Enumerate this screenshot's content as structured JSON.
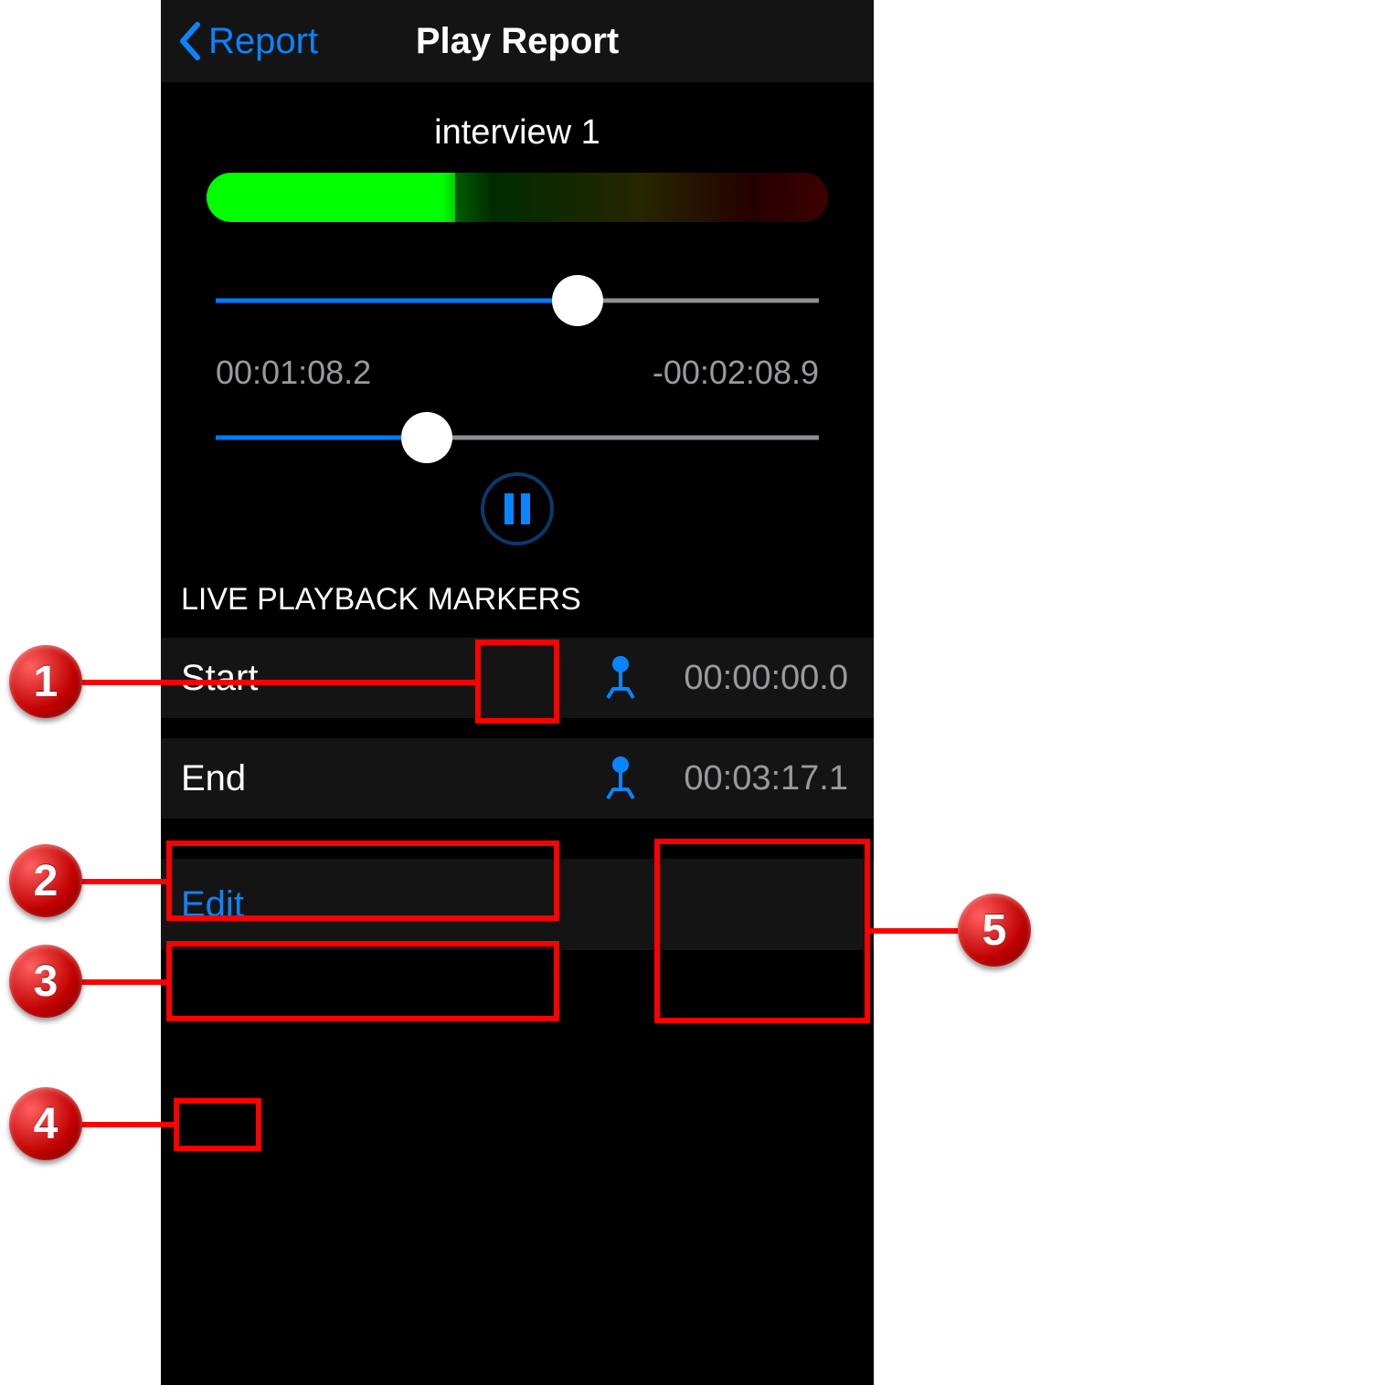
{
  "nav": {
    "back_label": "Report",
    "title": "Play Report"
  },
  "clip": {
    "title": "interview 1",
    "slider1_percent": 60,
    "time_elapsed": "00:01:08.2",
    "time_remaining": "-00:02:08.9",
    "slider2_percent": 35
  },
  "section": {
    "markers_header": "LIVE PLAYBACK MARKERS"
  },
  "markers": {
    "start_label": "Start",
    "start_time": "00:00:00.0",
    "end_label": "End",
    "end_time": "00:03:17.1"
  },
  "edit": {
    "label": "Edit"
  },
  "annotations": {
    "c1": "1",
    "c2": "2",
    "c3": "3",
    "c4": "4",
    "c5": "5"
  }
}
